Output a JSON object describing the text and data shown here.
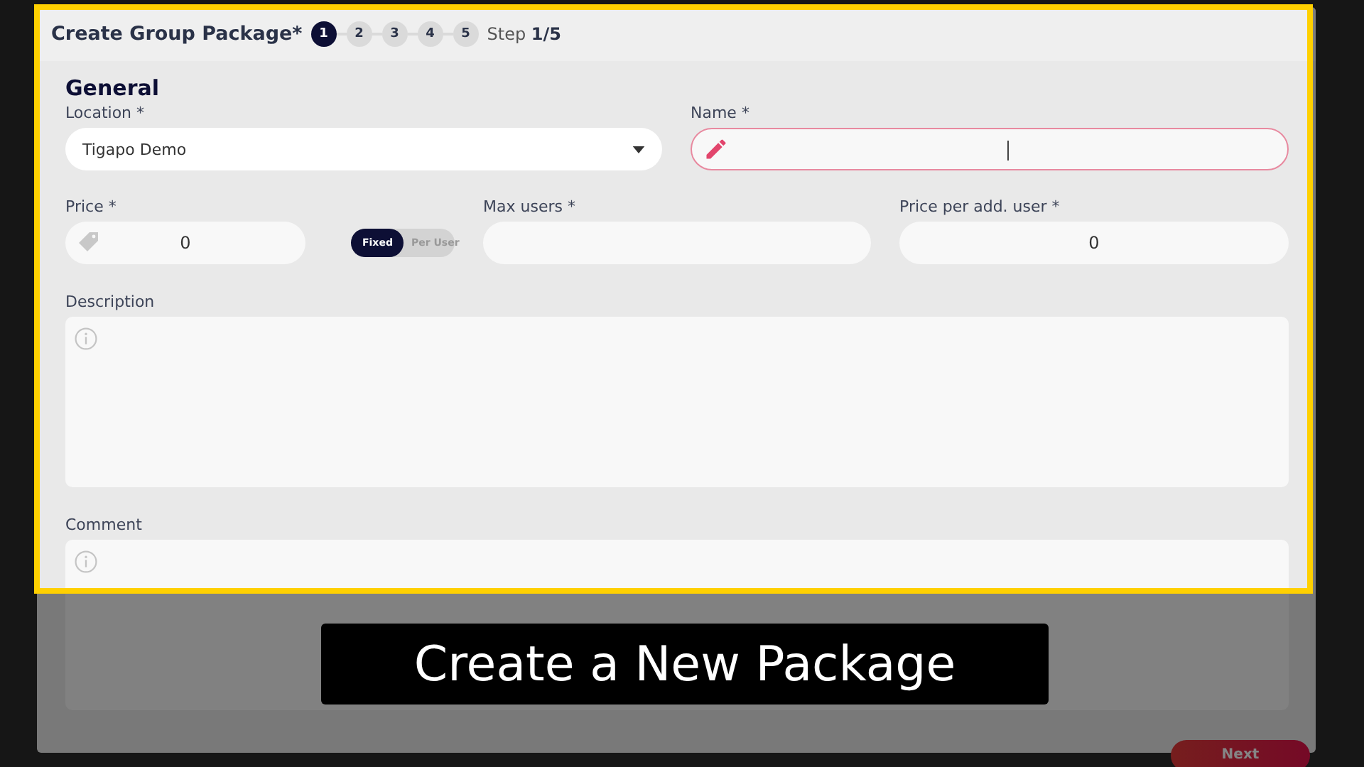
{
  "dialog": {
    "title": "Create Group Package*",
    "steps": [
      {
        "label": "1",
        "selected": true
      },
      {
        "label": "2",
        "selected": false
      },
      {
        "label": "3",
        "selected": false
      },
      {
        "label": "4",
        "selected": false
      },
      {
        "label": "5",
        "selected": false
      }
    ],
    "step_text": "Step **1/5**",
    "section": "General",
    "location": {
      "label": "Location *",
      "value": "Tigapo Demo"
    },
    "name": {
      "label": "Name *",
      "focused": true
    },
    "price": {
      "label": "Price *",
      "value": "0"
    },
    "price_mode": [
      {
        "label": "Fixed",
        "selected": true
      },
      {
        "label": "Per User",
        "selected": false
      }
    ],
    "max_users": {
      "label": "Max users *"
    },
    "price_per_user": {
      "label": "Price per add. user *",
      "value": "0"
    },
    "description": {
      "label": "Description"
    },
    "comment": {
      "label": "Comment"
    },
    "next_button": "Next"
  },
  "caption": "Create a New Package"
}
